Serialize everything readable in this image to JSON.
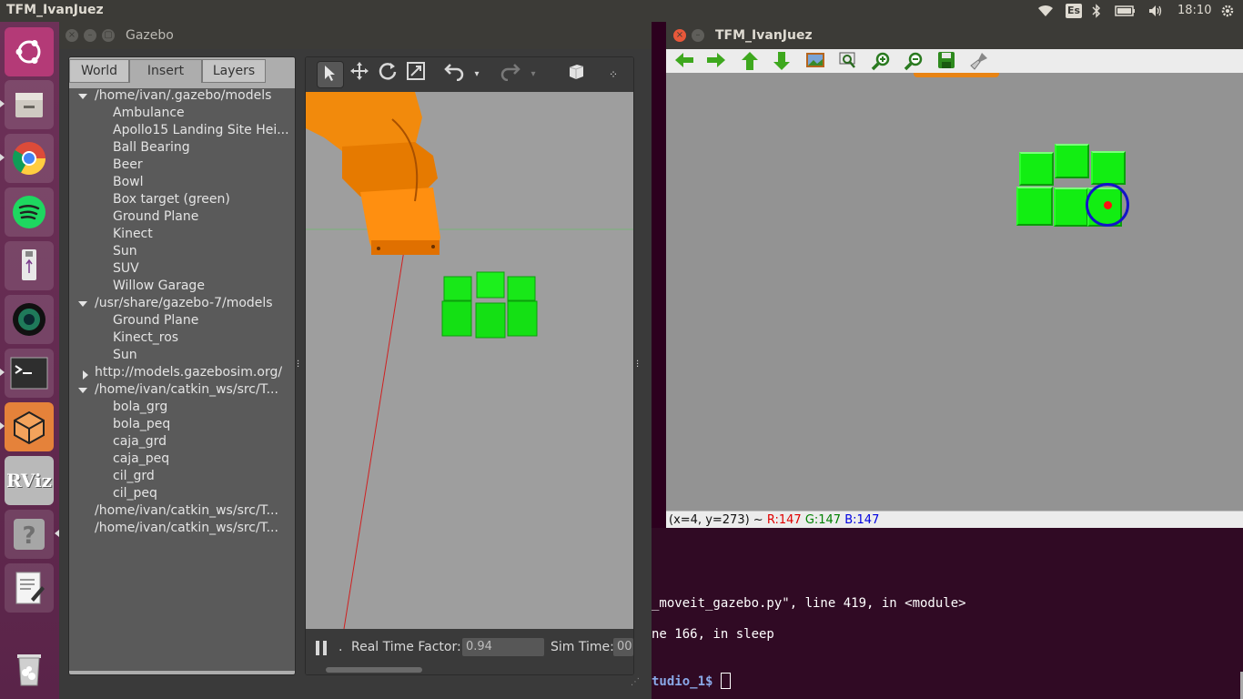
{
  "top_panel": {
    "title": "TFM_IvanJuez",
    "keyboard": "Es",
    "clock": "18:10"
  },
  "launcher": {
    "items": [
      "ubuntu-dash-icon",
      "files-icon",
      "chrome-icon",
      "spotify-icon",
      "usb-drive-icon",
      "camera-app-icon",
      "terminal-icon",
      "gazebo-icon",
      "rviz-icon",
      "help-icon",
      "text-editor-icon",
      "trash-icon"
    ],
    "rviz_label": "RViz"
  },
  "gazebo": {
    "title": "Gazebo",
    "tabs": [
      "World",
      "Insert",
      "Layers"
    ],
    "active_tab": "Insert",
    "tree": [
      {
        "label": "/home/ivan/.gazebo/models",
        "level": 0,
        "expander": "open"
      },
      {
        "label": "Ambulance",
        "level": 1
      },
      {
        "label": "Apollo15 Landing Site Hei...",
        "level": 1
      },
      {
        "label": "Ball Bearing",
        "level": 1
      },
      {
        "label": "Beer",
        "level": 1
      },
      {
        "label": "Bowl",
        "level": 1
      },
      {
        "label": "Box target (green)",
        "level": 1
      },
      {
        "label": "Ground Plane",
        "level": 1
      },
      {
        "label": "Kinect",
        "level": 1
      },
      {
        "label": "Sun",
        "level": 1
      },
      {
        "label": "SUV",
        "level": 1
      },
      {
        "label": "Willow Garage",
        "level": 1
      },
      {
        "label": "/usr/share/gazebo-7/models",
        "level": 0,
        "expander": "open"
      },
      {
        "label": "Ground Plane",
        "level": 1
      },
      {
        "label": "Kinect_ros",
        "level": 1
      },
      {
        "label": "Sun",
        "level": 1
      },
      {
        "label": "http://models.gazebosim.org/",
        "level": 0,
        "expander": "closed"
      },
      {
        "label": "/home/ivan/catkin_ws/src/T...",
        "level": 0,
        "expander": "open"
      },
      {
        "label": "bola_grg",
        "level": 1
      },
      {
        "label": "bola_peq",
        "level": 1
      },
      {
        "label": "caja_grd",
        "level": 1
      },
      {
        "label": "caja_peq",
        "level": 1
      },
      {
        "label": "cil_grd",
        "level": 1
      },
      {
        "label": "cil_peq",
        "level": 1
      },
      {
        "label": "/home/ivan/catkin_ws/src/T...",
        "level": 0
      },
      {
        "label": "/home/ivan/catkin_ws/src/T...",
        "level": 0
      }
    ],
    "toolbar_icons": [
      "select-arrow-icon",
      "translate-icon",
      "rotate-icon",
      "scale-icon",
      "undo-icon",
      "undo-dropdown-icon",
      "redo-icon",
      "redo-dropdown-icon",
      "box-shape-icon",
      "more-icon"
    ],
    "bottom": {
      "real_time_factor_label": "Real Time Factor:",
      "real_time_factor_value": "0.94",
      "sim_time_label": "Sim Time:",
      "sim_time_value": "00"
    }
  },
  "imgview": {
    "title": "TFM_IvanJuez",
    "toolbar_icons": [
      "back-arrow-icon",
      "forward-arrow-icon",
      "up-arrow-icon",
      "down-arrow-icon",
      "image-icon",
      "zoom-fit-icon",
      "zoom-in-icon",
      "zoom-out-icon",
      "save-icon",
      "clear-brush-icon"
    ],
    "status": {
      "coords": "(x=4, y=273) ~",
      "r": "R:147",
      "g": "G:147",
      "b": "B:147"
    }
  },
  "terminal": {
    "line1": "_moveit_gazebo.py\", line 419, in <module>",
    "line2": "ne 166, in sleep",
    "prompt": "tudio_1$ "
  },
  "colors": {
    "cube_green": "#12ee12",
    "robot_orange": "#ff8c00",
    "marker_blue": "#1010c8",
    "marker_red": "#ff0000"
  }
}
